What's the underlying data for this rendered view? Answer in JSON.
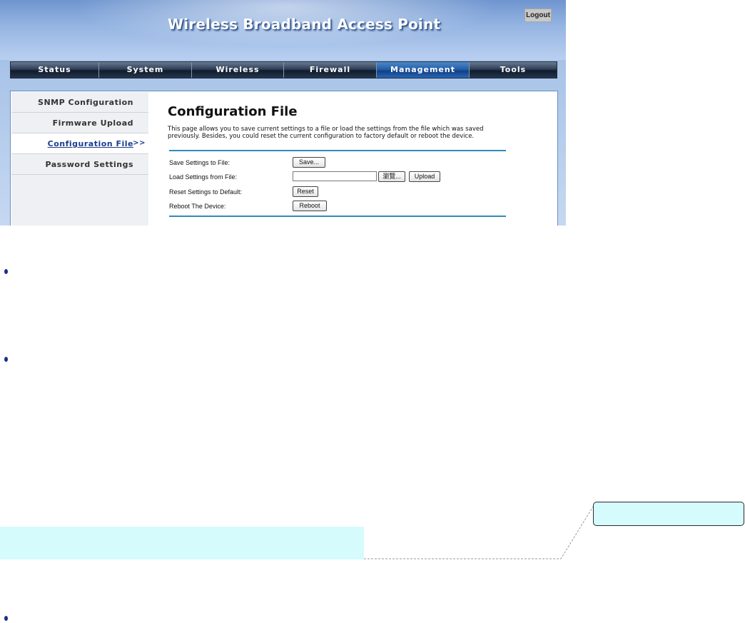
{
  "header": {
    "title": "Wireless Broadband Access Point",
    "logout_label": "Logout"
  },
  "nav": {
    "tabs": [
      {
        "label": "Status"
      },
      {
        "label": "System"
      },
      {
        "label": "Wireless"
      },
      {
        "label": "Firewall"
      },
      {
        "label": "Management",
        "active": true
      },
      {
        "label": "Tools"
      }
    ]
  },
  "sidebar": {
    "items": [
      {
        "label": "SNMP Configuration"
      },
      {
        "label": "Firmware Upload"
      },
      {
        "label": "Configuration File",
        "active": true,
        "marker": ">>"
      },
      {
        "label": "Password Settings"
      }
    ]
  },
  "main": {
    "title": "Configuration File",
    "description": "This page allows you to save current settings to a file or load the settings from the file which was saved previously. Besides, you could reset the current configuration to factory default or reboot the device.",
    "rows": [
      {
        "label": "Save Settings to File:",
        "button": "Save..."
      },
      {
        "label": "Load Settings from File:",
        "file_value": "",
        "browse_label": "瀏覽...",
        "button": "Upload"
      },
      {
        "label": "Reset Settings to Default:",
        "button": "Reset"
      },
      {
        "label": "Reboot The Device:",
        "button": "Reboot"
      }
    ]
  },
  "colors": {
    "nav_active": "#1f5aa3",
    "rule": "#2e8bb8",
    "callout_fill": "#d5fbfd",
    "bullet": "#1a2f8a"
  },
  "icons": {
    "bullet": "bullet-icon",
    "sidebar_marker": "double-chevron-right-icon"
  }
}
